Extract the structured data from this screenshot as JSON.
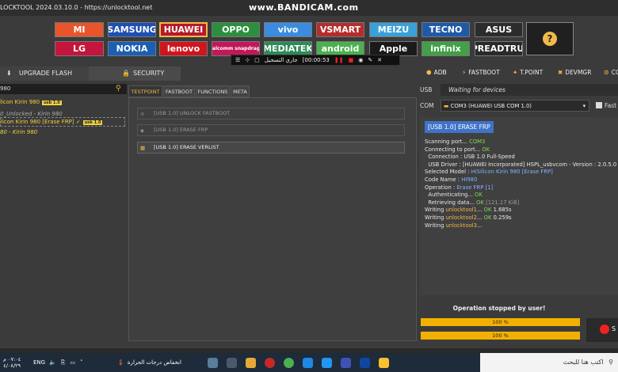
{
  "window": {
    "title": "LOCKTOOL 2024.03.10.0 - https://unlocktool.net",
    "watermark": "www.BANDICAM.com"
  },
  "brands": [
    {
      "label": "MI",
      "bg": "#e8552a"
    },
    {
      "label": "SAMSUNG",
      "bg": "#1e4fb3"
    },
    {
      "label": "HUAWEI",
      "bg": "#b51a2a",
      "selected": true
    },
    {
      "label": "OPPO",
      "bg": "#2b8f3e"
    },
    {
      "label": "vivo",
      "bg": "#3b8be0"
    },
    {
      "label": "VSMART",
      "bg": "#b52c2c"
    },
    {
      "label": "MEIZU",
      "bg": "#3aa0d8"
    },
    {
      "label": "TECNO",
      "bg": "#1e5aa8"
    },
    {
      "label": "ASUS",
      "bg": "#2c2c2c"
    },
    {
      "label": "LG",
      "bg": "#c4163c"
    },
    {
      "label": "NOKIA",
      "bg": "#1b5fb3"
    },
    {
      "label": "lenovo",
      "bg": "#d0151d"
    },
    {
      "label": "Qualcomm snapdragon",
      "bg": "#c2185b"
    },
    {
      "label": "MEDIATEK",
      "bg": "#2e8b57"
    },
    {
      "label": "android",
      "bg": "#4caf50"
    },
    {
      "label": "Apple",
      "bg": "#1a1a1a"
    },
    {
      "label": "infinix",
      "bg": "#43a047"
    },
    {
      "label": "SPREADTRUM",
      "bg": "#2a2a2a"
    }
  ],
  "help": {
    "label": "?"
  },
  "recorder": {
    "label": "جاري التسجيل",
    "time": "[00:00:53"
  },
  "left": {
    "tabs": [
      {
        "label": "UPGRADE FLASH"
      },
      {
        "label": "SECURITY"
      }
    ],
    "search_value": "980",
    "models": [
      {
        "text": "licon Kirin 980",
        "badge": "usb 1.0"
      },
      {
        "text": "0_Unlocked - Kirin 980"
      },
      {
        "text": "licon Kirin 980 [Erase FRP] ✓",
        "badge": "usb 1.0"
      },
      {
        "text": "80 - Kirin 980"
      }
    ]
  },
  "middle": {
    "tabs": [
      {
        "label": "TESTPOINT"
      },
      {
        "label": "FASTBOOT"
      },
      {
        "label": "FUNCTIONS"
      },
      {
        "label": "META"
      }
    ],
    "options": [
      {
        "label": "[USB 1.0] UNLOCK FASTBOOT"
      },
      {
        "label": "[USB 1.0] ERASE FRP"
      },
      {
        "label": "[USB 1.0] ERASE VERLIST"
      }
    ]
  },
  "right": {
    "tabs": [
      {
        "label": "ADB"
      },
      {
        "label": "FASTBOOT"
      },
      {
        "label": "T.POINT"
      },
      {
        "label": "DEVMGR"
      },
      {
        "label": "CO"
      }
    ],
    "usb_label": "USB",
    "usb_status": "Waiting for devices",
    "com_label": "COM",
    "com_value": "COM3 (HUAWEI USB COM 1.0)",
    "fast_label": "Fast",
    "log_header": "[USB 1.0] ERASE FRP",
    "log": [
      {
        "parts": [
          {
            "t": "Scanning port... "
          },
          {
            "t": "COM3",
            "c": "ok"
          }
        ]
      },
      {
        "parts": [
          {
            "t": "Connecting to port... "
          },
          {
            "t": "OK",
            "c": "ok"
          }
        ]
      },
      {
        "parts": [
          {
            "t": "  Connection : "
          },
          {
            "t": "USB 1.0 Full-Speed"
          }
        ]
      },
      {
        "parts": [
          {
            "t": "  USB Driver : "
          },
          {
            "t": "[HUAWEI Incorporated] HSPL_usbvcom - Version : 2.0.5.0"
          }
        ]
      },
      {
        "parts": [
          {
            "t": "Selected Model : "
          },
          {
            "t": "HiSilicon Kirin 980 [Erase FRP]",
            "c": "blu"
          }
        ]
      },
      {
        "parts": [
          {
            "t": "Code Name : "
          },
          {
            "t": "HI980",
            "c": "blu"
          }
        ]
      },
      {
        "parts": [
          {
            "t": "Operation : "
          },
          {
            "t": "Erase FRP [1]",
            "c": "blu"
          }
        ]
      },
      {
        "parts": [
          {
            "t": "  Authenticating... "
          },
          {
            "t": "OK",
            "c": "ok"
          }
        ]
      },
      {
        "parts": [
          {
            "t": "  Retrieving data... "
          },
          {
            "t": "OK",
            "c": "ok"
          },
          {
            "t": " [121.17 KiB]",
            "c": "gry"
          }
        ]
      },
      {
        "parts": [
          {
            "t": "Writing "
          },
          {
            "t": "unlocktool1",
            "c": "ora"
          },
          {
            "t": "... "
          },
          {
            "t": "OK",
            "c": "ok"
          },
          {
            "t": " 1.685s"
          }
        ]
      },
      {
        "parts": [
          {
            "t": "Writing "
          },
          {
            "t": "unlocktool2",
            "c": "ora"
          },
          {
            "t": "... "
          },
          {
            "t": "OK",
            "c": "ok"
          },
          {
            "t": " 0.259s"
          }
        ]
      },
      {
        "parts": [
          {
            "t": "Writing "
          },
          {
            "t": "unlocktool3",
            "c": "ora"
          },
          {
            "t": "..."
          }
        ]
      }
    ],
    "stop_message": "Operation stopped by user!",
    "progress": [
      {
        "label": "100 %",
        "value": 100
      },
      {
        "label": "100 %",
        "value": 100
      }
    ],
    "stop_button": "S"
  },
  "taskbar": {
    "lang": "ENG",
    "time": "٠٧:٠٤ م",
    "date": "٤/٠٨/٢٩",
    "weather": "انخفاض درجات الحرارة",
    "search_placeholder": "اكتب هنا للبحث"
  }
}
